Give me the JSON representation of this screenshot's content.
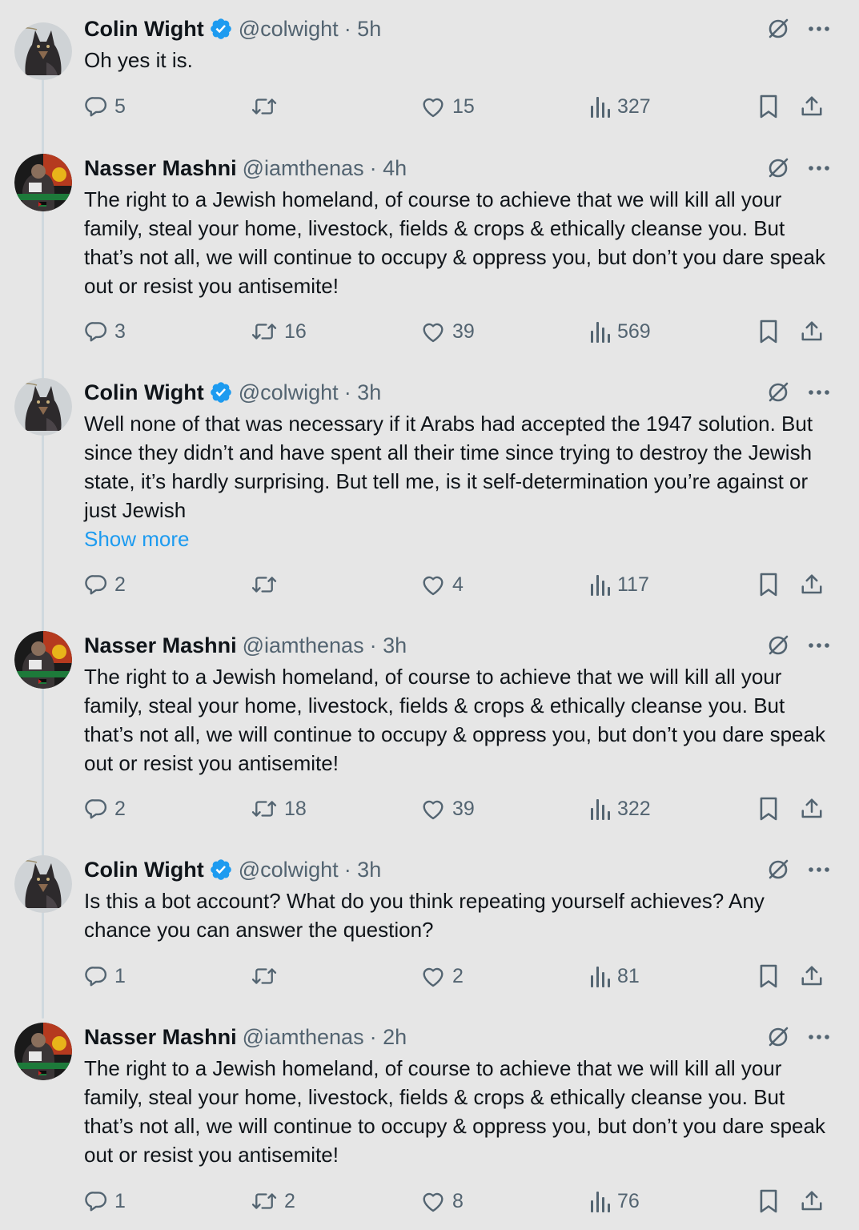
{
  "tweets": [
    {
      "name": "Colin Wight",
      "verified": true,
      "handle": "@colwight",
      "time": "· 5h",
      "text": "Oh yes it is.",
      "show_more": "",
      "replies": "5",
      "reposts": "",
      "likes": "15",
      "views": "327",
      "avatar": "dog-avatar"
    },
    {
      "name": "Nasser Mashni",
      "verified": false,
      "handle": "@iamthenas",
      "time": "· 4h",
      "text": "The right to a Jewish homeland, of course to achieve that we will kill all your family, steal your home, livestock, fields & crops & ethically cleanse you. But that’s not all, we will continue to occupy & oppress you, but don’t you dare speak out or resist you antisemite!",
      "show_more": "",
      "replies": "3",
      "reposts": "16",
      "likes": "39",
      "views": "569",
      "avatar": "person-avatar"
    },
    {
      "name": "Colin Wight",
      "verified": true,
      "handle": "@colwight",
      "time": "· 3h",
      "text": "Well none of that was necessary if it Arabs had accepted the 1947 solution. But since they didn’t and have spent all their time since trying to destroy the Jewish state, it’s hardly surprising. But tell me, is it self-determination you’re against or just Jewish",
      "show_more": "Show more",
      "replies": "2",
      "reposts": "",
      "likes": "4",
      "views": "117",
      "avatar": "dog-avatar"
    },
    {
      "name": "Nasser Mashni",
      "verified": false,
      "handle": "@iamthenas",
      "time": "· 3h",
      "text": "The right to a Jewish homeland, of course to achieve that we will kill all your family, steal your home, livestock, fields & crops & ethically cleanse you. But that’s not all, we will continue to occupy & oppress you, but don’t you dare speak out or resist you antisemite!",
      "show_more": "",
      "replies": "2",
      "reposts": "18",
      "likes": "39",
      "views": "322",
      "avatar": "person-avatar"
    },
    {
      "name": "Colin Wight",
      "verified": true,
      "handle": "@colwight",
      "time": "· 3h",
      "text": "Is this a bot account? What do you think repeating yourself achieves? Any chance you can answer the question?",
      "show_more": "",
      "replies": "1",
      "reposts": "",
      "likes": "2",
      "views": "81",
      "avatar": "dog-avatar"
    },
    {
      "name": "Nasser Mashni",
      "verified": false,
      "handle": "@iamthenas",
      "time": "· 2h",
      "text": "The right to a Jewish homeland, of course to achieve that we will kill all your family, steal your home, livestock, fields & crops & ethically cleanse you. But that’s not all, we will continue to occupy & oppress you, but don’t you dare speak out or resist you antisemite!",
      "show_more": "",
      "replies": "1",
      "reposts": "2",
      "likes": "8",
      "views": "76",
      "avatar": "person-avatar"
    }
  ],
  "colors": {
    "background": "#e6e6e6",
    "text": "#0f1419",
    "secondary": "#536471",
    "link": "#1d9bf0",
    "verified": "#1d9bf0"
  },
  "icons": [
    "verified-badge-icon",
    "grok-icon",
    "more-icon",
    "reply-icon",
    "repost-icon",
    "like-icon",
    "views-icon",
    "bookmark-icon",
    "share-icon"
  ]
}
